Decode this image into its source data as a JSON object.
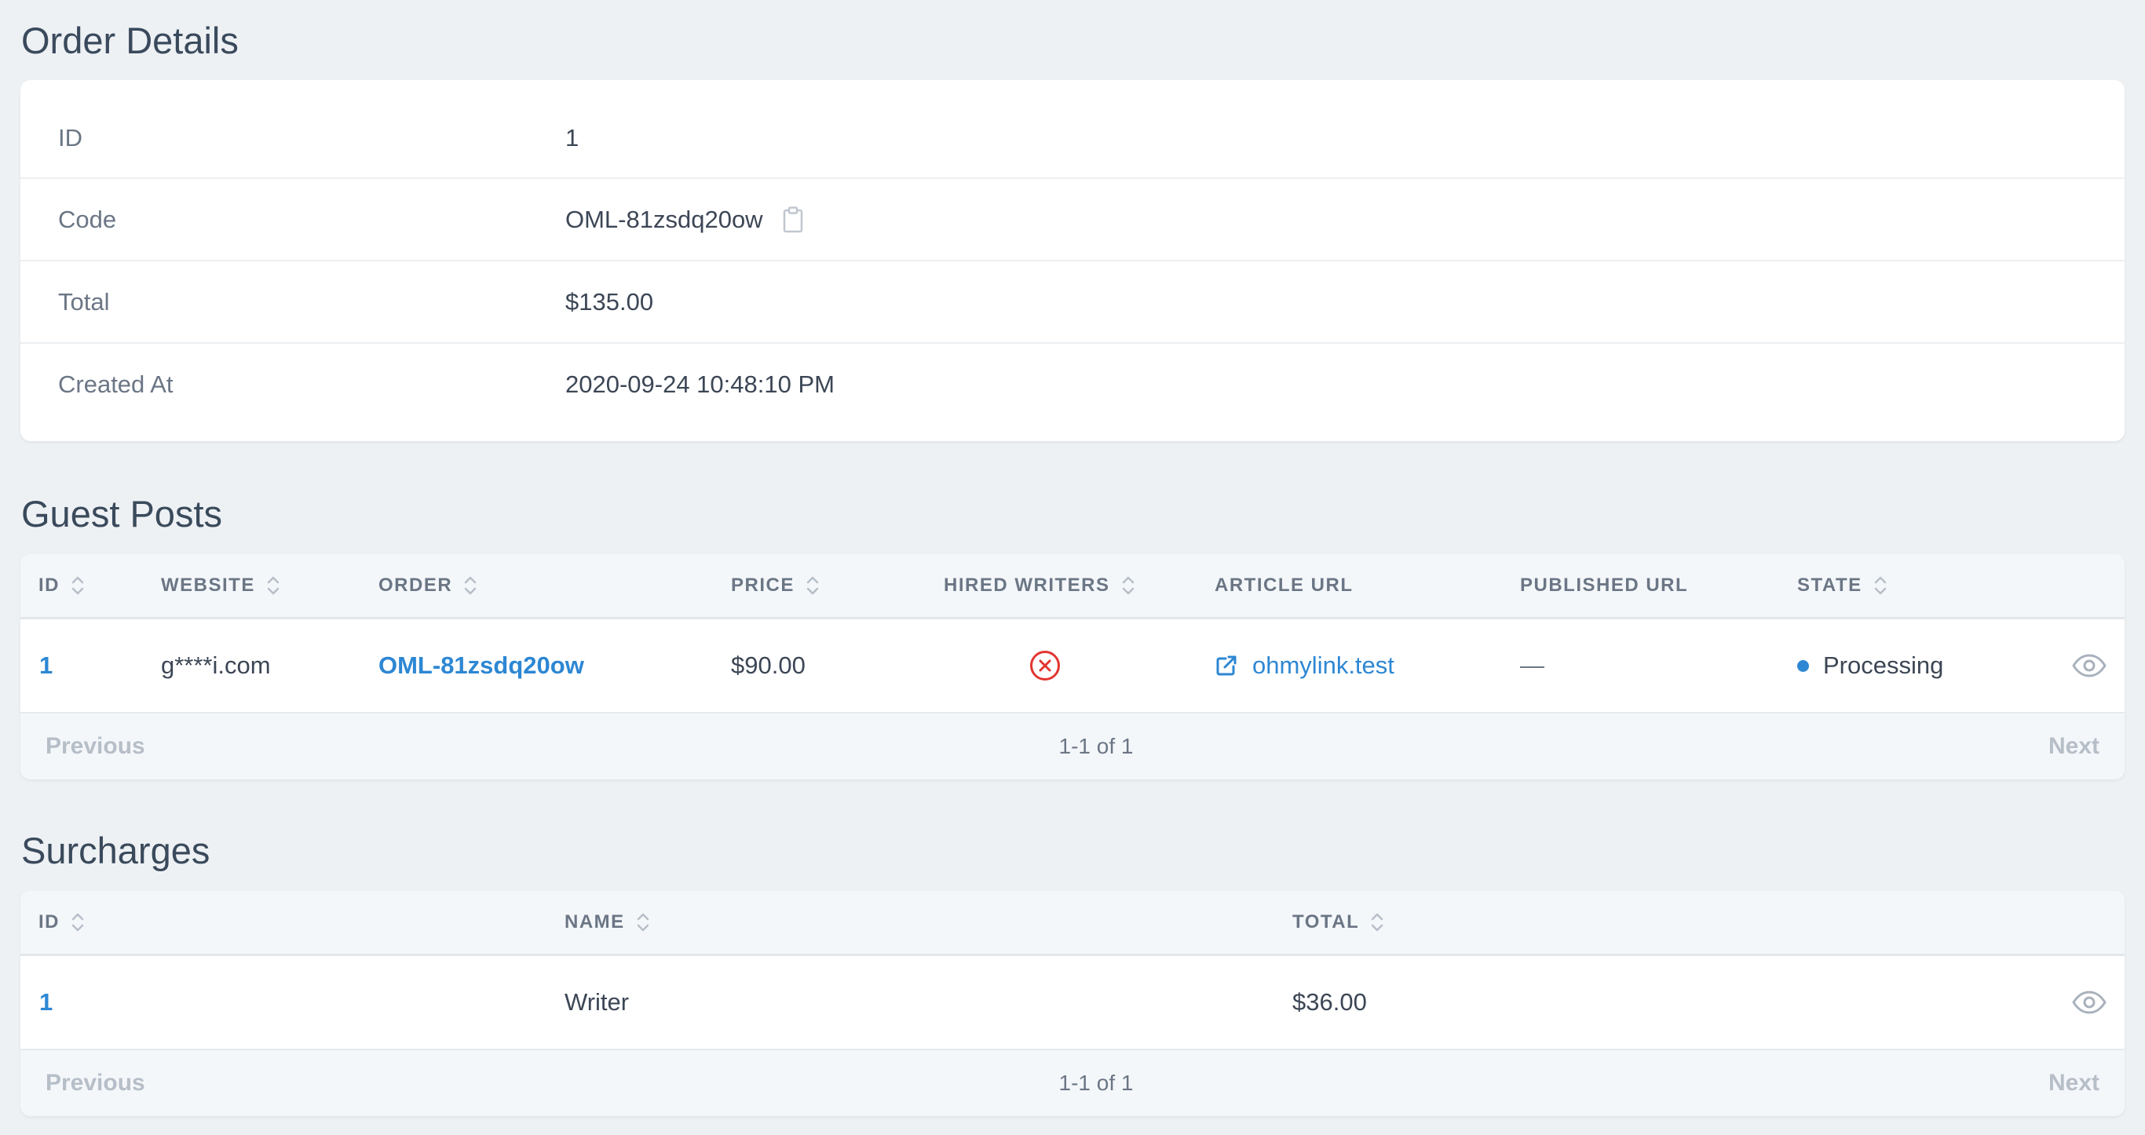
{
  "order_details": {
    "title": "Order Details",
    "rows": [
      {
        "label": "ID",
        "value": "1"
      },
      {
        "label": "Code",
        "value": "OML-81zsdq20ow"
      },
      {
        "label": "Total",
        "value": "$135.00"
      },
      {
        "label": "Created At",
        "value": "2020-09-24 10:48:10 PM"
      }
    ]
  },
  "guest_posts": {
    "title": "Guest Posts",
    "columns": [
      "ID",
      "WEBSITE",
      "ORDER",
      "PRICE",
      "HIRED WRITERS",
      "ARTICLE URL",
      "PUBLISHED URL",
      "STATE"
    ],
    "row": {
      "id": "1",
      "website": "g****i.com",
      "order": "OML-81zsdq20ow",
      "price": "$90.00",
      "hired_writers_icon": "x-circle-icon",
      "article_url": "ohmylink.test",
      "published_url": "—",
      "state": "Processing"
    },
    "pagination": {
      "previous": "Previous",
      "info": "1-1 of 1",
      "next": "Next"
    }
  },
  "surcharges": {
    "title": "Surcharges",
    "columns": [
      "ID",
      "NAME",
      "TOTAL"
    ],
    "row": {
      "id": "1",
      "name": "Writer",
      "total": "$36.00"
    },
    "pagination": {
      "previous": "Previous",
      "info": "1-1 of 1",
      "next": "Next"
    }
  },
  "colors": {
    "background": "#eef1f4",
    "link": "#2d87d3",
    "danger": "#e3342f",
    "muted": "#b6bec8"
  }
}
